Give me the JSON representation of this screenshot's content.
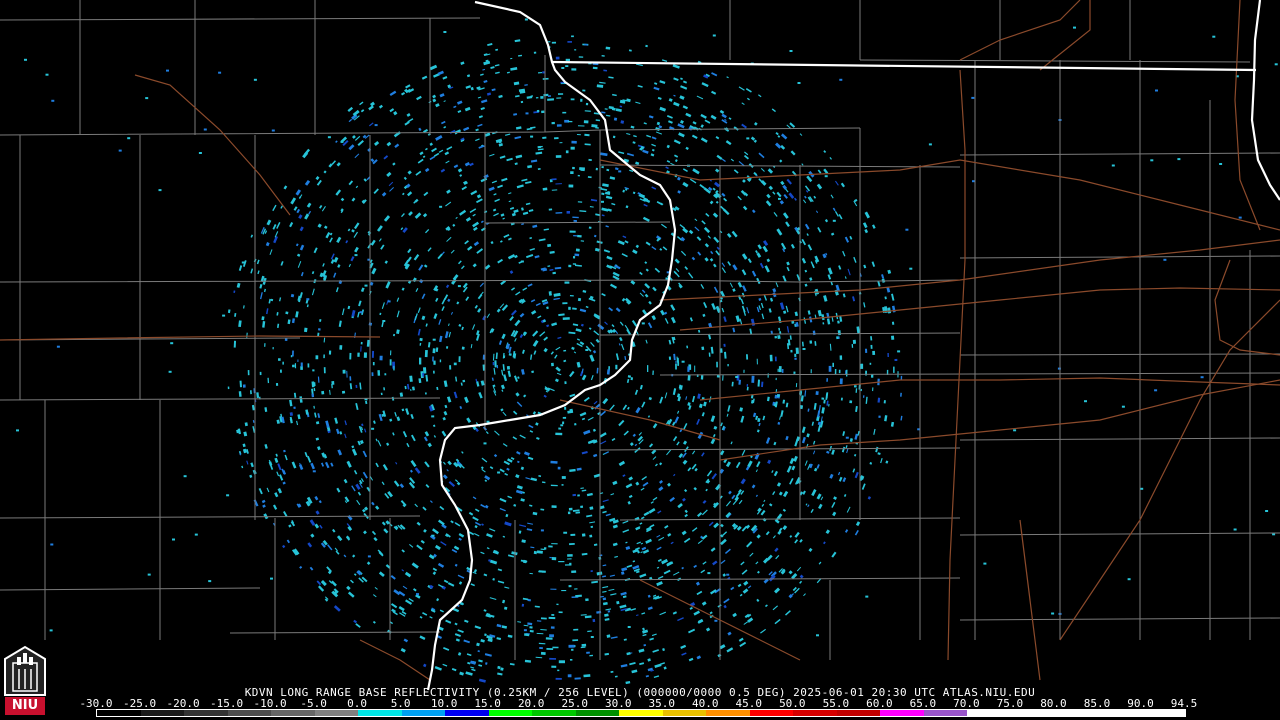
{
  "product": {
    "caption": "KDVN LONG RANGE BASE REFLECTIVITY (0.25KM / 256 LEVEL) (000000/0000 0.5 DEG) 2025-06-01 20:30 UTC  ATLAS.NIU.EDU"
  },
  "logo": {
    "text": "NIU"
  },
  "scale": {
    "labels": [
      "-30.0",
      "-25.0",
      "-20.0",
      "-15.0",
      "-10.0",
      "-5.0",
      "0.0",
      "5.0",
      "10.0",
      "15.0",
      "20.0",
      "25.0",
      "30.0",
      "35.0",
      "40.0",
      "45.0",
      "50.0",
      "55.0",
      "60.0",
      "65.0",
      "70.0",
      "75.0",
      "80.0",
      "85.0",
      "90.0",
      "94.5"
    ],
    "colors": [
      "#000000",
      "#1a1a1a",
      "#333333",
      "#4d4d4d",
      "#666666",
      "#808080",
      "#00e5e5",
      "#00a0f0",
      "#0000f0",
      "#00ff00",
      "#00c800",
      "#009000",
      "#ffff00",
      "#e7c000",
      "#ff9000",
      "#ff0000",
      "#d60000",
      "#c00000",
      "#ff00ff",
      "#9955c9",
      "#ffffff",
      "#ffffff",
      "#ffffff",
      "#ffffff",
      "#ffffff"
    ]
  },
  "map": {
    "colors": {
      "background": "#000000",
      "county_lines": "#7a7a7a",
      "state_lines": "#ffffff",
      "highways": "#8b4a2b",
      "echo_light": "#27c4d8",
      "echo_medium": "#1f7ee0",
      "echo_dark": "#1448c8"
    },
    "radar_site": "KDVN"
  }
}
